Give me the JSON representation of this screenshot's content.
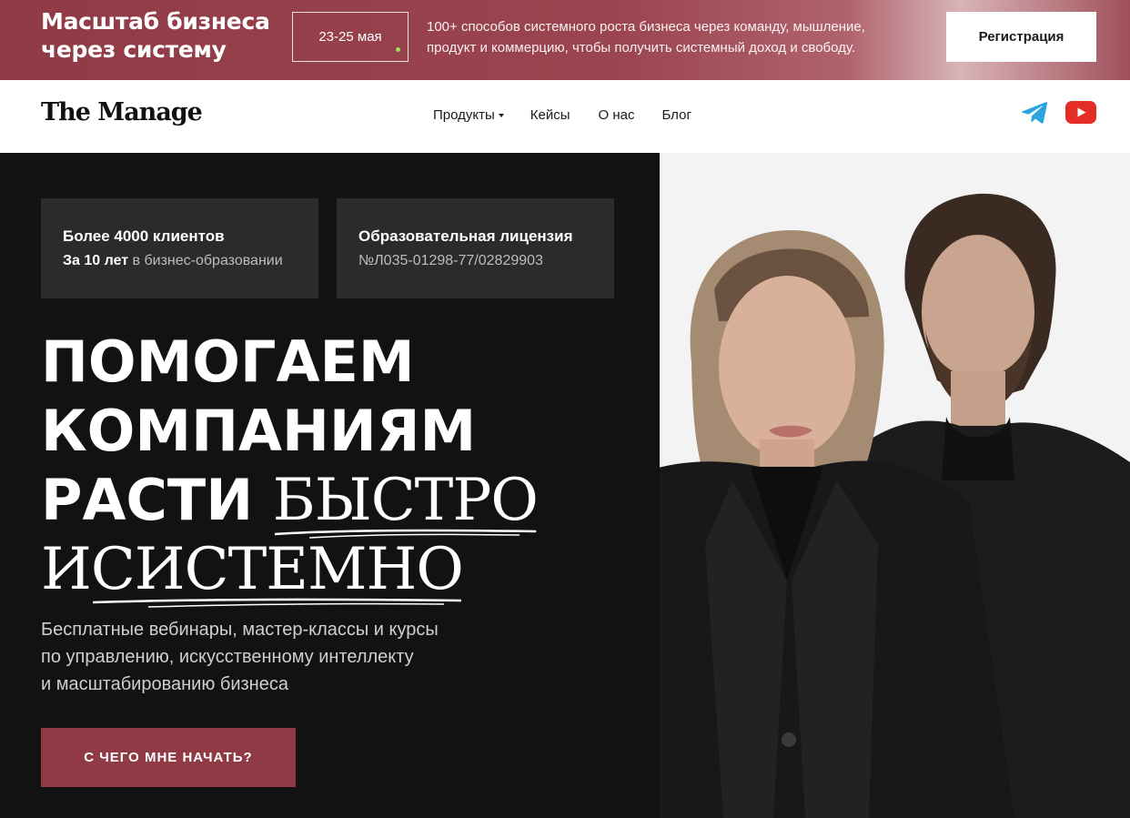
{
  "promo": {
    "title": "Масштаб бизнеса через систему",
    "dates": "23-25 мая",
    "description": "100+ способов системного роста бизнеса через команду, мышление, продукт и коммерцию, чтобы получить системный доход и свободу.",
    "register_label": "Регистрация",
    "background_color": "#9b4550",
    "dot_color": "#9be15d"
  },
  "header": {
    "logo": "The Manage",
    "nav": [
      {
        "label": "Продукты",
        "has_dropdown": true
      },
      {
        "label": "Кейсы"
      },
      {
        "label": "О нас"
      },
      {
        "label": "Блог"
      }
    ],
    "social": [
      {
        "icon": "telegram-icon",
        "color": "#2aa3df"
      },
      {
        "icon": "youtube-icon",
        "color": "#e52d27"
      }
    ]
  },
  "hero": {
    "stats": [
      {
        "title": "Более 4000 клиентов",
        "sub_bold": "За 10 лет",
        "sub": " в бизнес-образовании"
      },
      {
        "title": "Образовательная лицензия",
        "sub": "№Л035-01298-77/02829903"
      }
    ],
    "title_lines": {
      "line1": "Помогаем",
      "line2": "компаниям",
      "line3_start": "Расти ",
      "line3_accent": "БЫСТРО",
      "line4_start": "И ",
      "line4_accent": "СИСТЕМНО"
    },
    "description_lines": [
      "Бесплатные вебинары, мастер-классы и курсы",
      "по управлению, искусственному интеллекту",
      "и масштабированию бизнеса"
    ],
    "cta_label": "С ЧЕГО МНЕ НАЧАТЬ?",
    "accent_color": "#8f3a45"
  }
}
